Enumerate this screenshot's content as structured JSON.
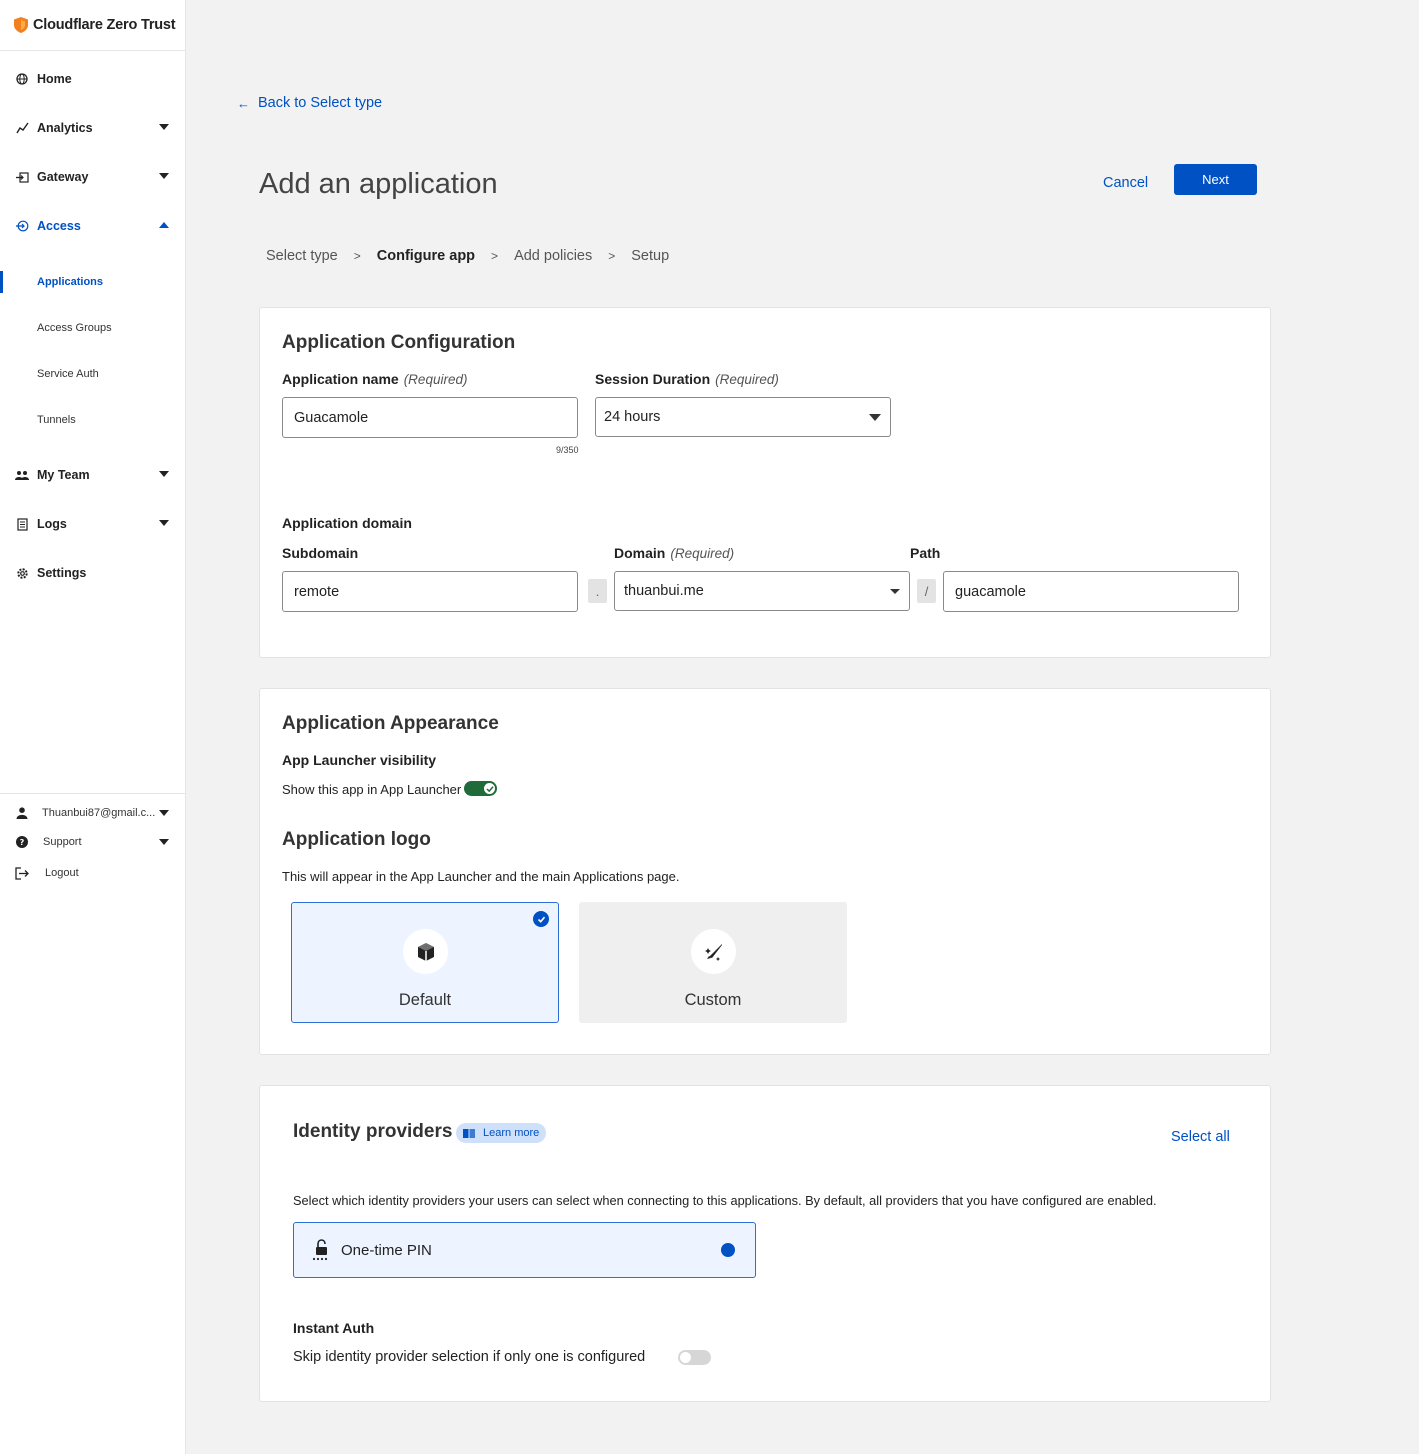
{
  "sidebar": {
    "brand": "Cloudflare Zero Trust",
    "items": [
      {
        "label": "Home",
        "icon": "globe-icon"
      },
      {
        "label": "Analytics",
        "icon": "analytics-icon"
      },
      {
        "label": "Gateway",
        "icon": "gateway-icon"
      },
      {
        "label": "Access",
        "icon": "access-icon"
      },
      {
        "label": "My Team",
        "icon": "team-icon"
      },
      {
        "label": "Logs",
        "icon": "logs-icon"
      },
      {
        "label": "Settings",
        "icon": "gear-icon"
      }
    ],
    "access_sub": [
      "Applications",
      "Access Groups",
      "Service Auth",
      "Tunnels"
    ],
    "footer": {
      "account": "Thuanbui87@gmail.c...",
      "support": "Support",
      "logout": "Logout"
    }
  },
  "header": {
    "back_link": "Back to Select type",
    "title": "Add an application",
    "cancel": "Cancel",
    "next": "Next"
  },
  "steps": [
    "Select type",
    "Configure app",
    "Add policies",
    "Setup"
  ],
  "step_separator": ">",
  "config": {
    "title": "Application Configuration",
    "app_name_label": "Application name",
    "required": "(Required)",
    "app_name_value": "Guacamole",
    "app_name_counter": "9/350",
    "session_label": "Session Duration",
    "session_value": "24 hours",
    "domain_title": "Application domain",
    "subdomain_label": "Subdomain",
    "subdomain_value": "remote",
    "domain_label": "Domain",
    "domain_value": "thuanbui.me",
    "path_label": "Path",
    "path_value": "guacamole",
    "dot": ".",
    "slash": "/"
  },
  "appearance": {
    "title": "Application Appearance",
    "launcher_label": "App Launcher visibility",
    "launcher_text": "Show this app in App Launcher",
    "launcher_enabled": true,
    "logo_title": "Application logo",
    "logo_desc": "This will appear in the App Launcher and the main Applications page.",
    "logo_options": [
      "Default",
      "Custom"
    ]
  },
  "identity": {
    "title": "Identity providers",
    "learn_more": "Learn more",
    "select_all": "Select all",
    "description": "Select which identity providers your users can select when connecting to this applications. By default, all providers that you have configured are enabled.",
    "provider": "One-time PIN",
    "instant_auth_label": "Instant Auth",
    "instant_auth_text": "Skip identity provider selection if only one is configured",
    "instant_auth_enabled": false
  },
  "colors": {
    "accent": "#0051c3",
    "toggle_on": "#1f6b3a",
    "brand_orange": "#f38020"
  }
}
